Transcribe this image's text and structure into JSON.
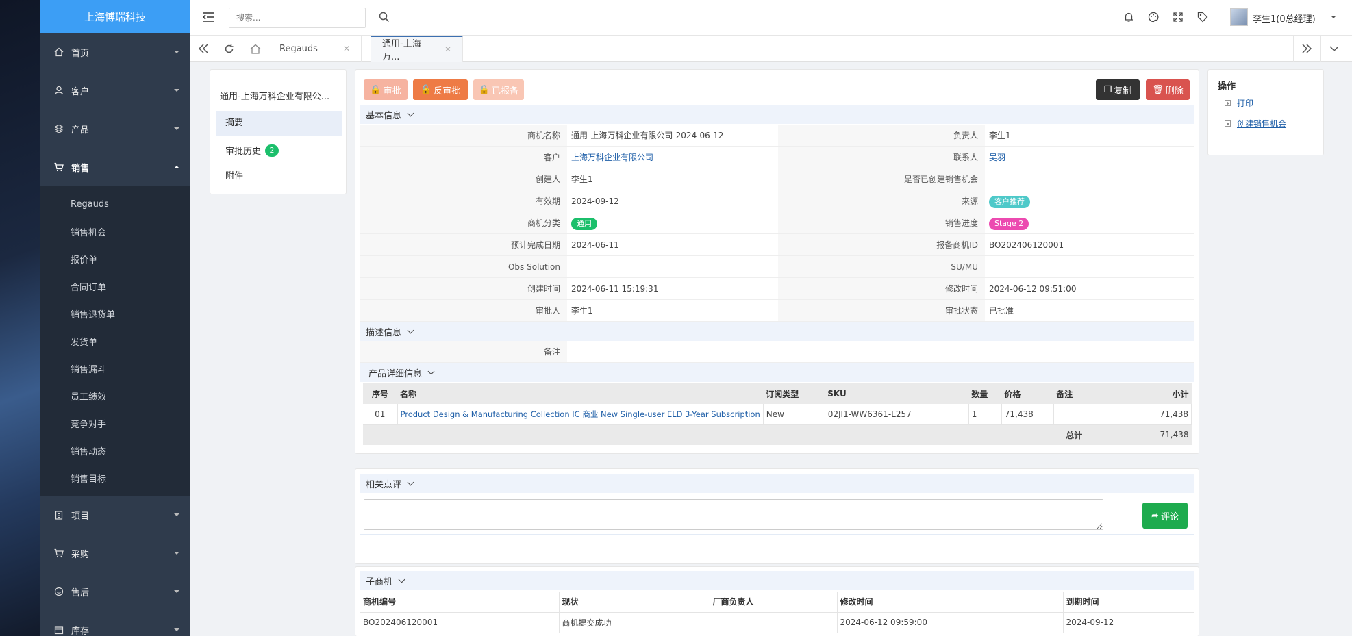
{
  "brand": "上海博瑞科技",
  "search_placeholder": "搜索...",
  "user_name": "李生1(0总经理)",
  "menu": {
    "home": "首页",
    "customer": "客户",
    "product": "产品",
    "sales": "销售",
    "sales_sub": [
      "Regauds",
      "销售机会",
      "报价单",
      "合同订单",
      "销售退货单",
      "发货单",
      "销售漏斗",
      "员工绩效",
      "竞争对手",
      "销售动态",
      "销售目标"
    ],
    "project": "项目",
    "purchase": "采购",
    "after_sales": "售后",
    "inventory": "库存"
  },
  "tabs": {
    "tab1": "Regauds",
    "tab2": "通用-上海万..."
  },
  "left_nav": {
    "title": "通用-上海万科企业有限公...",
    "summary": "摘要",
    "approval_history": "审批历史",
    "approval_count": "2",
    "attachments": "附件"
  },
  "actions": {
    "approve": "审批",
    "unapprove": "反审批",
    "filed": "已报备",
    "copy": "复制",
    "delete": "删除"
  },
  "basic": {
    "head": "基本信息",
    "opp_name_label": "商机名称",
    "opp_name": "通用-上海万科企业有限公司-2024-06-12",
    "owner_label": "负责人",
    "owner": "李生1",
    "customer_label": "客户",
    "customer": "上海万科企业有限公司",
    "contact_label": "联系人",
    "contact": "吴羽",
    "creator_label": "创建人",
    "creator": "李生1",
    "created_opp_label": "是否已创建销售机会",
    "validity_label": "有效期",
    "validity": "2024-09-12",
    "source_label": "来源",
    "source": "客户推荐",
    "category_label": "商机分类",
    "category": "通用",
    "progress_label": "销售进度",
    "progress": "Stage 2",
    "expected_date_label": "预计完成日期",
    "expected_date": "2024-06-11",
    "report_id_label": "报备商机ID",
    "report_id": "BO202406120001",
    "obs_label": "Obs Solution",
    "sumu_label": "SU/MU",
    "created_time_label": "创建时间",
    "created_time": "2024-06-11 15:19:31",
    "modified_time_label": "修改时间",
    "modified_time": "2024-06-12 09:51:00",
    "approver_label": "审批人",
    "approver": "李生1",
    "approval_status_label": "审批状态",
    "approval_status": "已批准"
  },
  "desc": {
    "head": "描述信息",
    "remark_label": "备注"
  },
  "product": {
    "head": "产品详细信息",
    "columns": [
      "序号",
      "名称",
      "订阅类型",
      "SKU",
      "数量",
      "价格",
      "备注",
      "小计"
    ],
    "row": [
      "01",
      "Product Design & Manufacturing Collection IC 商业 New Single-user ELD 3-Year Subscription",
      "New",
      "02JI1-WW6361-L257",
      "1",
      "71,438",
      "",
      "71,438"
    ],
    "total_label": "总计",
    "total": "71,438"
  },
  "comments": {
    "head": "相关点评",
    "submit": "评论"
  },
  "sub_opp": {
    "head": "子商机",
    "columns": [
      "商机编号",
      "现状",
      "厂商负责人",
      "修改时间",
      "到期时间"
    ],
    "row": [
      "BO202406120001",
      "商机提交成功",
      "",
      "2024-06-12 09:59:00",
      "2024-09-12"
    ]
  },
  "ops": {
    "head": "操作",
    "print": "打印",
    "create_opp": "创建销售机会"
  },
  "colors": {
    "brand": "#3c9ef5",
    "sidebar": "#2f3b4c",
    "approve_btn": "#f6b3a0",
    "unapprove_btn": "#ee7b45",
    "copy_btn": "#333333",
    "delete_btn": "#d9534f",
    "comment_btn": "#1eab4e",
    "badge_teal": "#4ec9c9",
    "badge_green": "#1bbf6b",
    "badge_pink": "#ec4ab0"
  }
}
